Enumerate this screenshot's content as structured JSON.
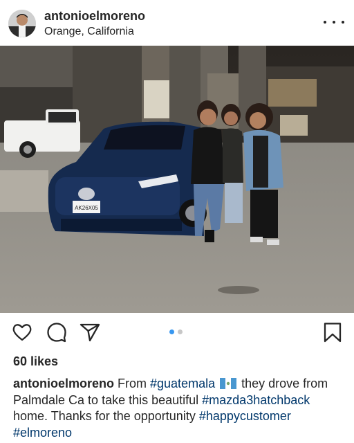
{
  "post": {
    "username": "antonioelmoreno",
    "location": "Orange, California",
    "more_icon": "more-horizontal-icon",
    "photo_plate": "AK26X05",
    "likes": "60 likes",
    "carousel": {
      "count": 2,
      "active": 0
    },
    "caption": {
      "username": "antonioelmoreno",
      "text_1": " From ",
      "hashtag_1": "#guatemala",
      "flag_icon": "guatemala-flag-icon",
      "text_2": " they drove from Palmdale Ca to take this beautiful ",
      "hashtag_2": "#mazda3hatchback",
      "text_3": " home. Thanks for the opportunity ",
      "hashtag_3": "#happycustomer",
      "text_4": " ",
      "hashtag_4": "#elmoreno"
    }
  },
  "actions": {
    "like_icon": "heart-icon",
    "comment_icon": "comment-icon",
    "share_icon": "send-icon",
    "save_icon": "bookmark-icon"
  },
  "colors": {
    "text": "#262626",
    "hashtag": "#00376b",
    "dot_active": "#3897f0",
    "dot_inactive": "#c7c7c7",
    "car": "#152a4e"
  }
}
